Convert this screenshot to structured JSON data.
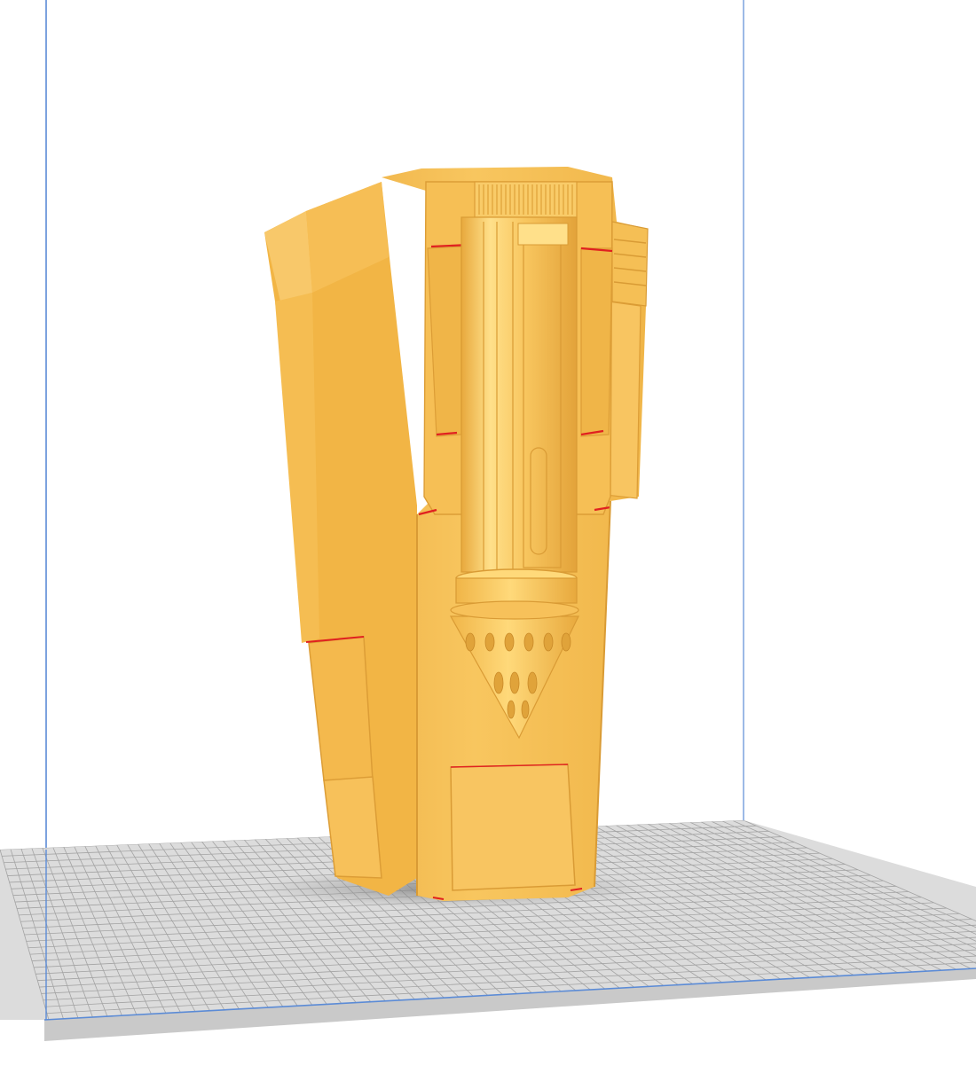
{
  "app": {
    "title": ""
  },
  "viewport": {
    "background_color": "#ffffff",
    "build_volume_color": "#5b8bd6",
    "bed_color": "#d8d8d8",
    "bed_grid_color": "#9a9a9a",
    "model_color": "#f7c25c",
    "model_shadow_color": "#d99f35",
    "model_highlight_color": "#ffe08a",
    "overhang_color": "#e02020",
    "object_shadow_color": "#8a8a8a"
  },
  "model": {
    "icon": "3d-model-object",
    "selected": false
  }
}
